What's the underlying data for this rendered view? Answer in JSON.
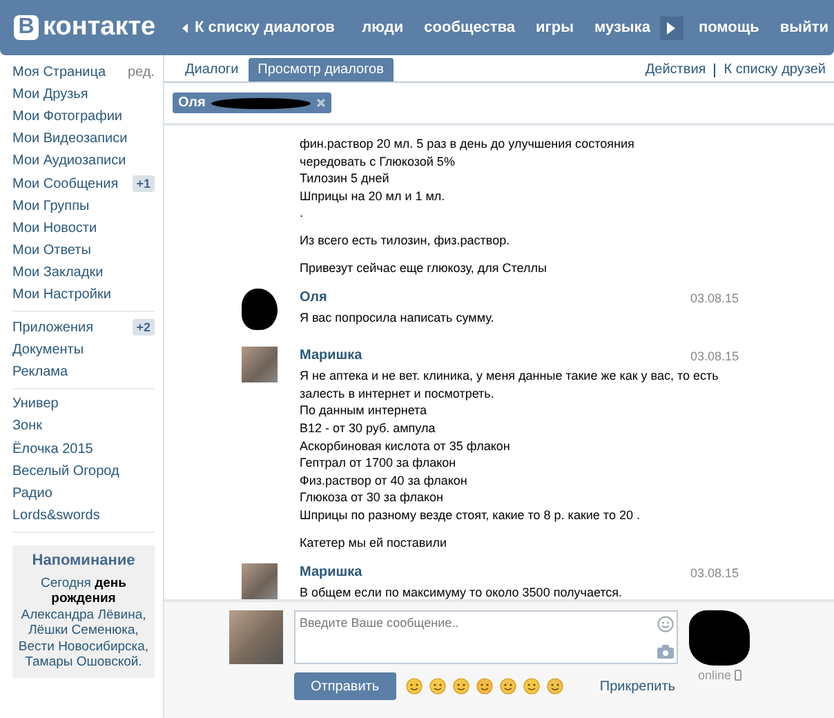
{
  "header": {
    "logo": {
      "letter": "В",
      "text": "контакте"
    },
    "back_link": "К списку диалогов",
    "nav": [
      "люди",
      "сообщества",
      "игры",
      "музыка"
    ],
    "nav_after_player": [
      "помощь",
      "выйти"
    ]
  },
  "sidebar": {
    "groups": [
      [
        {
          "label": "Моя Страница",
          "extra": "ред."
        },
        {
          "label": "Мои Друзья"
        },
        {
          "label": "Мои Фотографии"
        },
        {
          "label": "Мои Видеозаписи"
        },
        {
          "label": "Мои Аудиозаписи"
        },
        {
          "label": "Мои Сообщения",
          "badge": "+1"
        },
        {
          "label": "Мои Группы"
        },
        {
          "label": "Мои Новости"
        },
        {
          "label": "Мои Ответы"
        },
        {
          "label": "Мои Закладки"
        },
        {
          "label": "Мои Настройки"
        }
      ],
      [
        {
          "label": "Приложения",
          "badge": "+2"
        },
        {
          "label": "Документы"
        },
        {
          "label": "Реклама"
        }
      ],
      [
        {
          "label": "Универ"
        },
        {
          "label": "Зонк"
        },
        {
          "label": "Ёлочка 2015"
        },
        {
          "label": "Веселый Огород"
        },
        {
          "label": "Радио"
        },
        {
          "label": "Lords&swords"
        }
      ]
    ],
    "reminder": {
      "title": "Напоминание",
      "text": "Сегодня **день рождения** Александра Лёвина, Лёшки Семенюка, Вести Новосибирска, Тамары Ошовской."
    }
  },
  "tabs": [
    {
      "label": "Диалоги",
      "selected": false
    },
    {
      "label": "Просмотр диалогов",
      "selected": true
    }
  ],
  "actions": [
    "Действия",
    "К списку друзей"
  ],
  "chip": {
    "name": "Оля"
  },
  "messages": [
    {
      "kind": "continuation",
      "paragraphs": [
        [
          "фин.раствор 20 мл. 5 раз в день до улучшения состояния",
          "чередовать с Глюкозой 5%",
          "Тилозин 5 дней",
          "Шприцы на 20 мл и 1 мл.",
          "."
        ],
        [
          "Из всего есть тилозин, физ.раствор."
        ],
        [
          "Привезут сейчас еще глюкозу, для Стеллы"
        ]
      ]
    },
    {
      "kind": "redacted_avatar",
      "author": "Оля",
      "date": "03.08.15",
      "paragraphs": [
        [
          "Я вас попросила написать сумму."
        ]
      ]
    },
    {
      "kind": "photo_avatar",
      "author": "Маришка",
      "date": "03.08.15",
      "paragraphs": [
        [
          "Я не аптека и не вет. клиника, у меня данные такие же как у вас, то есть залесть в интернет и посмотреть.",
          "По данным интернета",
          "B12 - от 30 руб. ампула",
          "Аскорбиновая кислота от 35 флакон",
          "Гептрал от 1700 за флакон",
          "Физ.раствор от 40 за флакон",
          "Глюкоза от 30 за флакон",
          "Шприцы по разному везде стоят, какие то 8 р. какие то 20 ."
        ],
        [
          "Катетер мы ей поставили"
        ]
      ]
    },
    {
      "kind": "photo_avatar",
      "author": "Маришка",
      "date": "03.08.15",
      "paragraphs": [
        [
          "В общем если по максимуму то около 3500 получается."
        ]
      ]
    }
  ],
  "compose": {
    "placeholder": "Введите Ваше сообщение..",
    "send": "Отправить",
    "attach": "Прикрепить",
    "status": "online"
  }
}
